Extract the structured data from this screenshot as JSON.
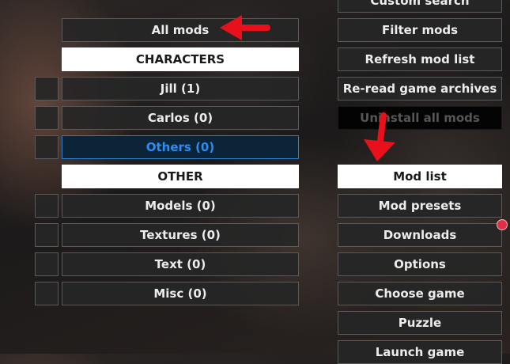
{
  "left_panel": {
    "all_mods": "All mods",
    "characters_header": "CHARACTERS",
    "characters": [
      "Jill (1)",
      "Carlos (0)",
      "Others (0)"
    ],
    "other_header": "OTHER",
    "other": [
      "Models (0)",
      "Textures (0)",
      "Text (0)",
      "Misc (0)"
    ]
  },
  "right_panel": {
    "custom_search": "Custom search",
    "filter_mods": "Filter mods",
    "refresh_mod_list": "Refresh mod list",
    "reread_archives": "Re-read game archives",
    "uninstall_all": "Uninstall all mods",
    "mod_list_header": "Mod list",
    "mod_presets": "Mod presets",
    "downloads": "Downloads",
    "options": "Options",
    "choose_game": "Choose game",
    "puzzle": "Puzzle",
    "launch_game": "Launch game"
  },
  "colors": {
    "selected_text": "#2c8ef0",
    "annotation_arrow": "#e8101a",
    "notification_dot": "#e03048"
  },
  "icons": [
    "red-arrow-left-icon",
    "red-arrow-down-icon",
    "notification-dot-icon"
  ]
}
